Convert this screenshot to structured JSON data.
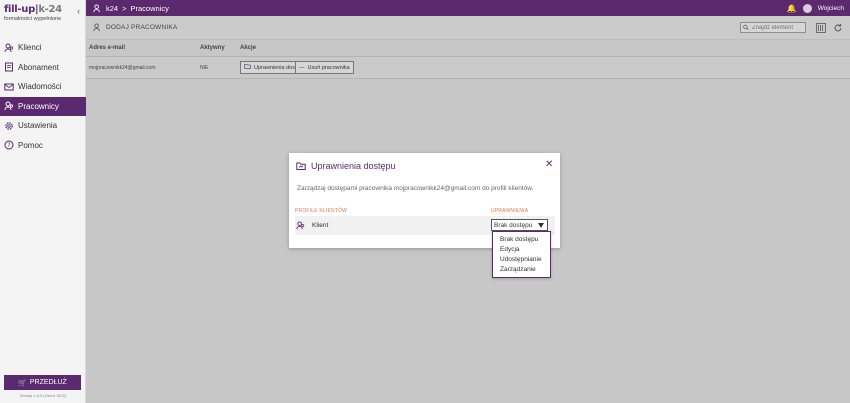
{
  "logo": {
    "brand_a": "fill-up",
    "brand_sep": "|",
    "brand_b": "k-24",
    "tagline": "formalności wypełnione"
  },
  "sidebar": {
    "items": [
      {
        "label": "Klienci",
        "icon": "users-icon"
      },
      {
        "label": "Abonament",
        "icon": "document-icon"
      },
      {
        "label": "Wiadomości",
        "icon": "mail-icon"
      },
      {
        "label": "Pracownicy",
        "icon": "employees-icon"
      },
      {
        "label": "Ustawienia",
        "icon": "gear-icon"
      },
      {
        "label": "Pomoc",
        "icon": "help-icon"
      }
    ],
    "extend_label": "PRZEDŁUŻ",
    "version": "Wersja 1.6.9 (Client 1502)"
  },
  "topbar": {
    "crumb_root": "k24",
    "crumb_sep": ">",
    "crumb_page": "Pracownicy",
    "user_name": "Wojciech"
  },
  "toolbar": {
    "add_label": "DODAJ PRACOWNIKA",
    "search_placeholder": "Znajdź element"
  },
  "table": {
    "headers": [
      "Adres e-mail",
      "Aktywny",
      "Akcje"
    ],
    "rows": [
      {
        "email": "mojpracownikk24@gmail.com",
        "active": "NIE",
        "perm_button": "Uprawnienia dostępu",
        "remove_button": "Usuń pracownika"
      }
    ]
  },
  "modal": {
    "title": "Uprawnienia dostępu",
    "description": "Zarządzaj dostępami pracownika mojpracownikk24@gmail.com do profili klientów.",
    "col_profiles": "PROFILE KLIENTÓW",
    "col_permissions": "UPRAWNIENIA",
    "profile": "Klient",
    "selected": "Brak dostępu",
    "options": [
      "Brak dostępu",
      "Edycja",
      "Udostępnianie",
      "Zarządzanie"
    ]
  },
  "colors": {
    "brand": "#5b2a6e",
    "accent_label": "#e0784a",
    "overlay": "#c7c7c7"
  }
}
